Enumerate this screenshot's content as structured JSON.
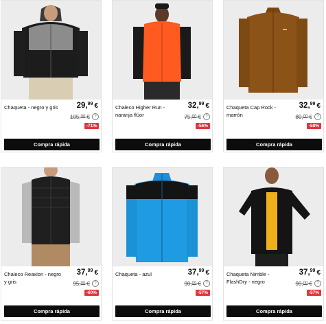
{
  "products": [
    {
      "name": "Chaqueta - negro y gris",
      "price_int": "29",
      "price_dec": "99",
      "currency": "€",
      "old_int": "105",
      "old_dec": "00",
      "old_cur": "€",
      "discount": "-71%",
      "cta": "Compra rápida",
      "image_icon": "jacket-black-grey"
    },
    {
      "name": "Chaleco Higher Run - naranja flúor",
      "price_int": "32",
      "price_dec": "99",
      "currency": "€",
      "old_int": "75",
      "old_dec": "00",
      "old_cur": "€",
      "discount": "-56%",
      "cta": "Compra rápida",
      "image_icon": "vest-orange"
    },
    {
      "name": "Chaqueta Cap Rock - marrón",
      "price_int": "32",
      "price_dec": "99",
      "currency": "€",
      "old_int": "80",
      "old_dec": "00",
      "old_cur": "€",
      "discount": "-58%",
      "cta": "Compra rápida",
      "image_icon": "jacket-brown"
    },
    {
      "name": "Chaleco Reaxion - negro y gris",
      "price_int": "37",
      "price_dec": "99",
      "currency": "€",
      "old_int": "95",
      "old_dec": "00",
      "old_cur": "€",
      "discount": "-60%",
      "cta": "Compra rápida",
      "image_icon": "vest-black"
    },
    {
      "name": "Chaqueta - azul",
      "price_int": "37",
      "price_dec": "99",
      "currency": "€",
      "old_int": "90",
      "old_dec": "00",
      "old_cur": "€",
      "discount": "-57%",
      "cta": "Compra rápida",
      "image_icon": "jacket-blue"
    },
    {
      "name": "Chaqueta Nimble - FlashDry - negro",
      "price_int": "37",
      "price_dec": "99",
      "currency": "€",
      "old_int": "90",
      "old_dec": "00",
      "old_cur": "€",
      "discount": "-57%",
      "cta": "Compra rápida",
      "image_icon": "jacket-black-yellow"
    }
  ],
  "help_glyph": "?",
  "colors": {
    "badge": "#e2363f",
    "button": "#0c0c0c"
  }
}
